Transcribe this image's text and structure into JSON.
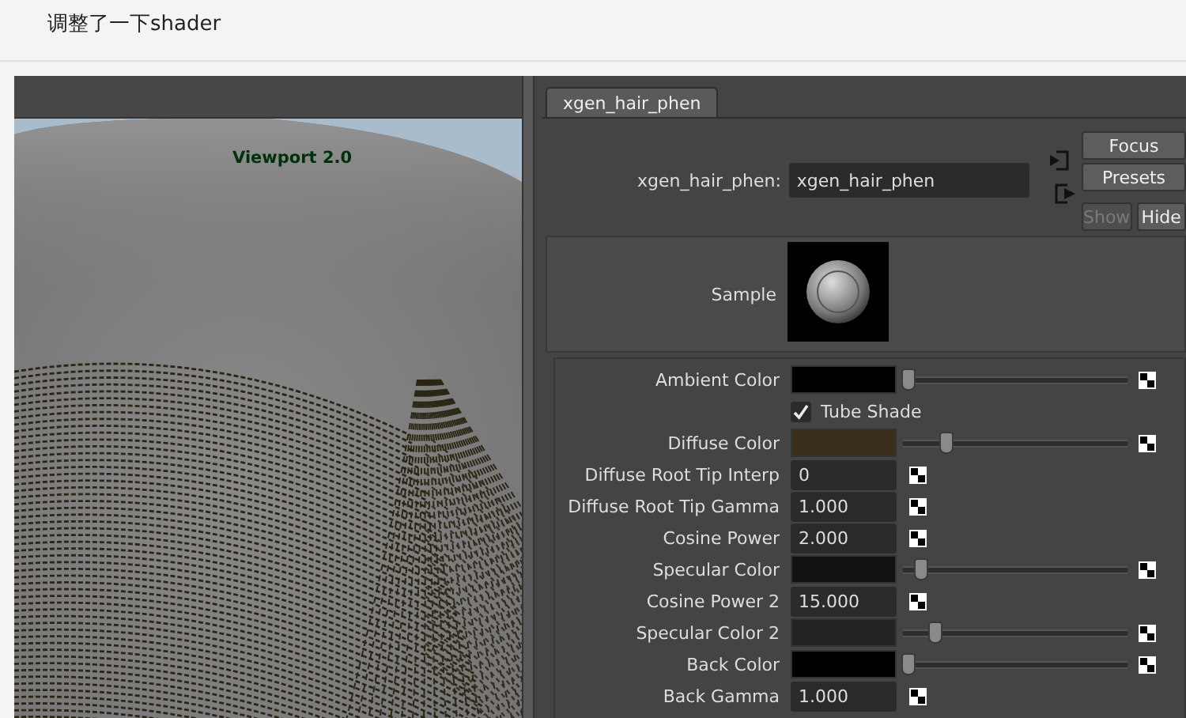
{
  "post": {
    "title": "调整了一下shader"
  },
  "viewport": {
    "label": "Viewport 2.0"
  },
  "attribute_editor": {
    "tabs": [
      {
        "label": "xgen_hair_phen",
        "selected": true
      }
    ],
    "node": {
      "label": "xgen_hair_phen:",
      "value": "xgen_hair_phen"
    },
    "buttons": [
      {
        "label": "Focus",
        "disabled": false
      },
      {
        "label": "Presets",
        "disabled": false
      }
    ],
    "show_hide": [
      {
        "label": "Show",
        "disabled": true
      },
      {
        "label": "Hide",
        "disabled": false
      }
    ],
    "sample": {
      "label": "Sample"
    },
    "attributes": [
      {
        "kind": "color",
        "label": "Ambient Color",
        "color": "#000000",
        "level": 0.02
      },
      {
        "kind": "checkbox",
        "label": "Tube Shade",
        "checked": true
      },
      {
        "kind": "color",
        "label": "Diffuse Color",
        "color": "#3a2f1a",
        "level": 0.19
      },
      {
        "kind": "number",
        "label": "Diffuse Root Tip Interp",
        "value": "0"
      },
      {
        "kind": "number",
        "label": "Diffuse Root Tip Gamma",
        "value": "1.000"
      },
      {
        "kind": "number",
        "label": "Cosine Power",
        "value": "2.000"
      },
      {
        "kind": "color",
        "label": "Specular Color",
        "color": "#111111",
        "level": 0.08
      },
      {
        "kind": "number",
        "label": "Cosine Power 2",
        "value": "15.000"
      },
      {
        "kind": "color",
        "label": "Specular Color 2",
        "color": "#222222",
        "level": 0.14
      },
      {
        "kind": "color",
        "label": "Back Color",
        "color": "#000000",
        "level": 0.02
      },
      {
        "kind": "number",
        "label": "Back Gamma",
        "value": "1.000"
      }
    ]
  }
}
